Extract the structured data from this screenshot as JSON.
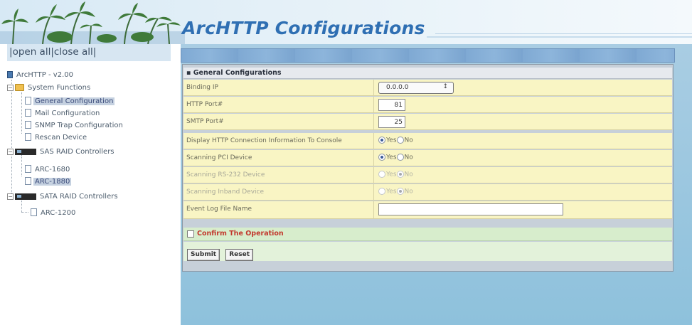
{
  "header": {
    "title": "ArcHTTP Configurations",
    "logo_icon": "palm-trees-icon"
  },
  "nav": {
    "open_all": "open all",
    "separator": "|",
    "close_all": "close all",
    "tree": {
      "root": "ArcHTTP - v2.00",
      "system_functions": "System Functions",
      "general_configuration": "General Configuration",
      "mail_configuration": "Mail Configuration",
      "snmp_trap_configuration": "SNMP Trap Configuration",
      "rescan_device": "Rescan Device",
      "sas_raid_controllers": "SAS RAID Controllers",
      "arc_1680": "ARC-1680",
      "arc_1880": "ARC-1880",
      "sata_raid_controllers": "SATA RAID Controllers",
      "arc_1200": "ARC-1200"
    },
    "selected_items": [
      "General Configuration",
      "ARC-1880"
    ]
  },
  "form": {
    "section_title": "▪ General Configurations",
    "fields": {
      "binding_ip": {
        "label": "Binding IP",
        "value": "0.0.0.0",
        "arrow": "↕"
      },
      "http_port": {
        "label": "HTTP Port#",
        "value": "81"
      },
      "smtp_port": {
        "label": "SMTP Port#",
        "value": "25"
      },
      "display_http": {
        "label": "Display HTTP Connection Information To Console",
        "yes": "Yes",
        "no": "No",
        "selected": "Yes",
        "enabled": true
      },
      "scan_pci": {
        "label": "Scanning PCI Device",
        "yes": "Yes",
        "no": "No",
        "selected": "Yes",
        "enabled": true
      },
      "scan_rs232": {
        "label": "Scanning RS-232 Device",
        "yes": "Yes",
        "no": "No",
        "selected": "No",
        "enabled": false
      },
      "scan_inband": {
        "label": "Scanning Inband Device",
        "yes": "Yes",
        "no": "No",
        "selected": "No",
        "enabled": false
      },
      "event_log": {
        "label": "Event Log File Name",
        "value": ""
      }
    },
    "confirm_label": "Confirm The Operation",
    "confirm_checked": false,
    "submit_label": "Submit",
    "reset_label": "Reset"
  },
  "colors": {
    "title": "#2f6fb3",
    "form_row": "#f9f5c4",
    "confirm_row": "#d7edcc",
    "confirm_text": "#c2382d",
    "main_bg": "#9ec8e0"
  }
}
